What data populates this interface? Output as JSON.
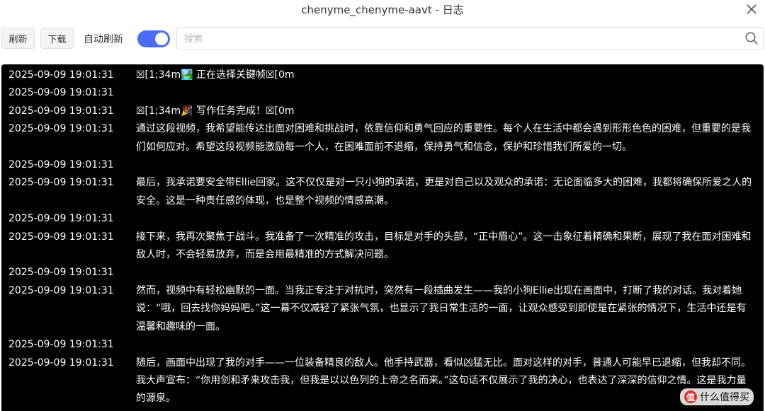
{
  "window": {
    "title": "chenyme_chenyme-aavt - 日志"
  },
  "toolbar": {
    "refresh_label": "刷新",
    "download_label": "下载",
    "auto_refresh_label": "自动刷新",
    "auto_refresh_enabled": true,
    "search_placeholder": "搜索",
    "search_value": ""
  },
  "colors": {
    "accent": "#4a6cf7",
    "log_background": "#000000",
    "log_text": "#ffffff"
  },
  "logs": [
    {
      "time": "2025-09-09 19:01:31",
      "message": "☒[1;34m🏞️ 正在选择关键帧☒[0m"
    },
    {
      "time": "2025-09-09 19:01:31",
      "message": ""
    },
    {
      "time": "2025-09-09 19:01:31",
      "message": "☒[1;34m🎉 写作任务完成！☒[0m"
    },
    {
      "time": "2025-09-09 19:01:31",
      "message": "通过这段视频，我希望能传达出面对困难和挑战时，依靠信仰和勇气回应的重要性。每个人在生活中都会遇到形形色色的困难，但重要的是我们如何应对。希望这段视频能激励每一个人，在困难面前不退缩，保持勇气和信念，保护和珍惜我们所爱的一切。"
    },
    {
      "time": "2025-09-09 19:01:31",
      "message": ""
    },
    {
      "time": "2025-09-09 19:01:31",
      "message": "最后，我承诺要安全带Ellie回家。这不仅仅是对一只小狗的承诺，更是对自己以及观众的承诺：无论面临多大的困难，我都将确保所爱之人的安全。这是一种责任感的体现，也是整个视频的情感高潮。"
    },
    {
      "time": "2025-09-09 19:01:31",
      "message": ""
    },
    {
      "time": "2025-09-09 19:01:31",
      "message": "接下来，我再次聚焦于战斗。我准备了一次精准的攻击，目标是对手的头部，“正中眉心”。这一击象征着精确和果断，展现了我在面对困难和敌人时，不会轻易放弃，而是会用最精准的方式解决问题。"
    },
    {
      "time": "2025-09-09 19:01:31",
      "message": ""
    },
    {
      "time": "2025-09-09 19:01:31",
      "message": "然而，视频中有轻松幽默的一面。当我正专注于对抗时，突然有一段插曲发生——我的小狗Ellie出现在画面中，打断了我的对话。我对着她说：“哦，回去找你妈妈吧。”这一幕不仅减轻了紧张气氛，也显示了我日常生活的一面，让观众感受到即使是在紧张的情况下，生活中还是有温馨和趣味的一面。"
    },
    {
      "time": "2025-09-09 19:01:31",
      "message": ""
    },
    {
      "time": "2025-09-09 19:01:31",
      "message": "随后，画面中出现了我的对手——一位装备精良的敌人。他手持武器，看似凶猛无比。面对这样的对手，普通人可能早已退缩，但我却不同。我大声宣布：“你用剑和矛来攻击我，但我是以以色列的上帝之名而来。”这句话不仅展示了我的决心，也表达了深深的信仰之情。这是我力量的源泉。"
    }
  ],
  "watermark": {
    "logo_char": "值",
    "text": "什么值得买"
  }
}
